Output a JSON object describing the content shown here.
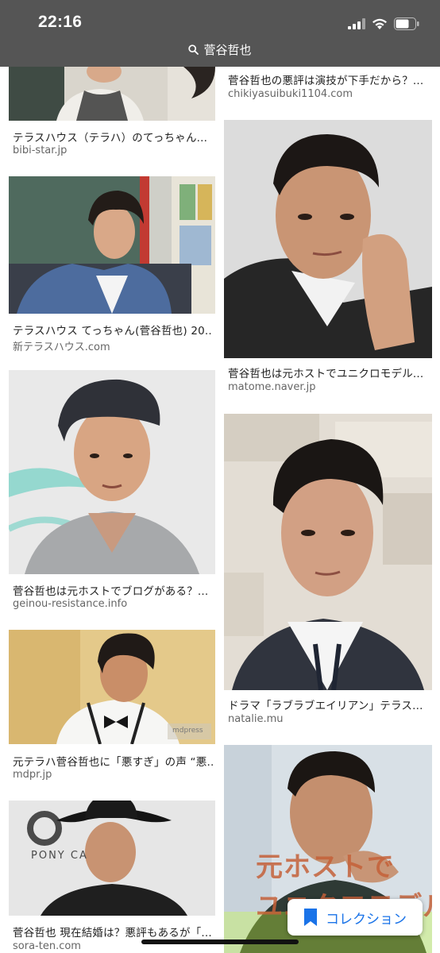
{
  "status_bar": {
    "time": "22:16"
  },
  "search": {
    "query": "菅谷哲也"
  },
  "results_left": [
    {
      "title": "テラスハウス（テラハ）のてっちゃん...",
      "source": "bibi-star.jp"
    },
    {
      "title": "テラスハウス てっちゃん(菅谷哲也) 20...",
      "source": "新テラスハウス.com"
    },
    {
      "title": "菅谷哲也は元ホストでブログがある？...",
      "source": "geinou-resistance.info"
    },
    {
      "title": "元テラハ菅谷哲也に「悪すぎ」の声 “悪...",
      "source": "mdpr.jp"
    },
    {
      "title": "菅谷哲也 現在結婚は？悪評もあるが「...",
      "source": "sora-ten.com"
    }
  ],
  "results_right": [
    {
      "title": "菅谷哲也の悪評は演技が下手だから？...",
      "source": "chikiyasuibuki1104.com"
    },
    {
      "title": "菅谷哲也は元ホストでユニクロモデル...",
      "source": "matome.naver.jp"
    },
    {
      "title": "ドラマ「ラブラブエイリアン」テラス...",
      "source": "natalie.mu"
    }
  ],
  "image_overlays": {
    "right_4_line1": "元ホストで",
    "right_4_line2": "ユニクロモデル？",
    "left_5_sign": "PONY CA",
    "left_4_watermark": "mdpress"
  },
  "collection_button": {
    "label": "コレクション"
  },
  "colors": {
    "header_bg": "#555555",
    "link_blue": "#1a73e8",
    "source_gray": "#666666"
  }
}
